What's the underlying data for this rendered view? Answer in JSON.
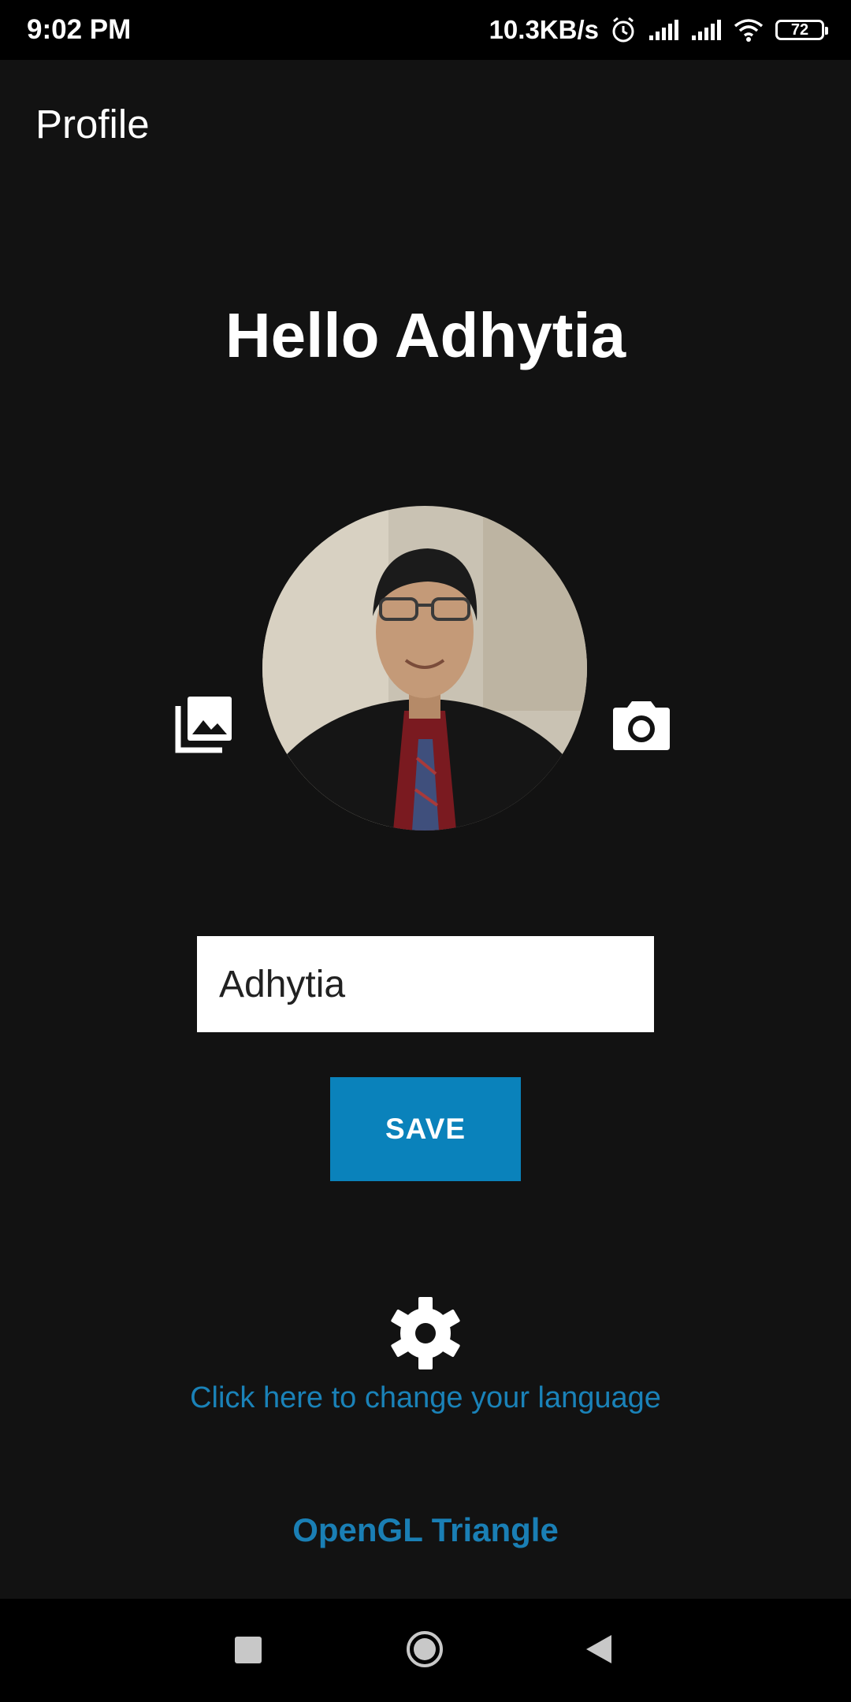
{
  "status_bar": {
    "time": "9:02 PM",
    "net_speed": "10.3KB/s",
    "battery_level": "72",
    "icons": [
      "alarm-icon",
      "signal-icon",
      "signal-icon",
      "wifi-icon",
      "battery-icon"
    ]
  },
  "toolbar": {
    "title": "Profile"
  },
  "profile": {
    "greeting": "Hello Adhytia",
    "name_value": "Adhytia",
    "save_label": "SAVE",
    "language_link": "Click here to change your language",
    "opengl_link": "OpenGL Triangle"
  },
  "icons": {
    "gallery": "photo-library-icon",
    "camera": "camera-icon",
    "settings": "gear-icon"
  },
  "colors": {
    "background": "#121212",
    "accent_button": "#0a82bb",
    "link": "#1a82b8"
  },
  "nav_bar": {
    "buttons": [
      "recents-button",
      "home-button",
      "back-button"
    ]
  }
}
